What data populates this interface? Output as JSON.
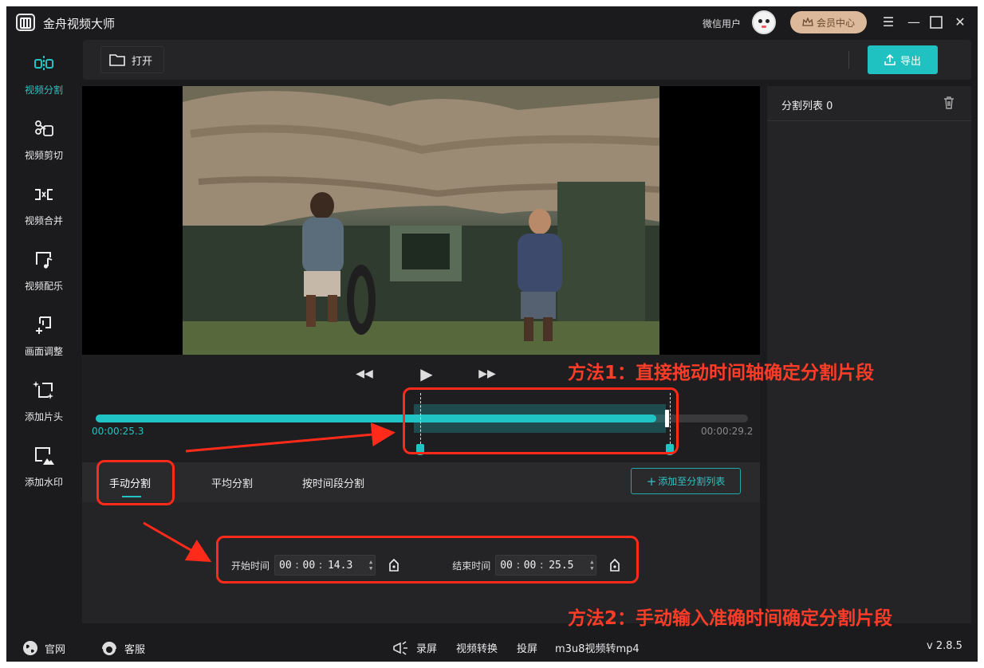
{
  "app": {
    "title": "金舟视频大师",
    "user_name": "微信用户",
    "vip_label": "会员中心",
    "version": "v 2.8.5"
  },
  "sidebar": {
    "items": [
      {
        "label": "视频分割",
        "icon": "split-icon",
        "active": true
      },
      {
        "label": "视频剪切",
        "icon": "scissors-icon",
        "active": false
      },
      {
        "label": "视频合并",
        "icon": "merge-icon",
        "active": false
      },
      {
        "label": "视频配乐",
        "icon": "music-icon",
        "active": false
      },
      {
        "label": "画面调整",
        "icon": "crop-icon",
        "active": false
      },
      {
        "label": "添加片头",
        "icon": "intro-icon",
        "active": false
      },
      {
        "label": "添加水印",
        "icon": "watermark-icon",
        "active": false
      }
    ]
  },
  "toolbar": {
    "open_label": "打开",
    "export_label": "导出"
  },
  "timeline": {
    "current_time": "00:00:25.3",
    "total_time": "00:00:29.2",
    "progress_fraction": 0.86
  },
  "split": {
    "tabs": [
      "手动分割",
      "平均分割",
      "按时间段分割"
    ],
    "active_tab": 0,
    "add_to_list_label": "添加至分割列表",
    "start_label": "开始时间",
    "start_time": {
      "h": "00",
      "m": "00",
      "s": "14.3"
    },
    "end_label": "结束时间",
    "end_time": {
      "h": "00",
      "m": "00",
      "s": "25.5"
    }
  },
  "right_panel": {
    "title": "分割列表 0"
  },
  "footer": {
    "links": [
      {
        "label": "官网",
        "icon": "globe-icon"
      },
      {
        "label": "客服",
        "icon": "headset-icon"
      },
      {
        "label": "录屏",
        "icon": "megaphone-icon"
      },
      {
        "label": "视频转换",
        "icon": ""
      },
      {
        "label": "投屏",
        "icon": ""
      },
      {
        "label": "m3u8视频转mp4",
        "icon": ""
      }
    ]
  },
  "annotations": {
    "method1": "方法1：直接拖动时间轴确定分割片段",
    "method2": "方法2：手动输入准确时间确定分割片段",
    "color": "#ff3c28"
  },
  "colors": {
    "accent": "#21c4c4",
    "background": "#1b1b1d",
    "vip_gold": "#dcb99b"
  }
}
